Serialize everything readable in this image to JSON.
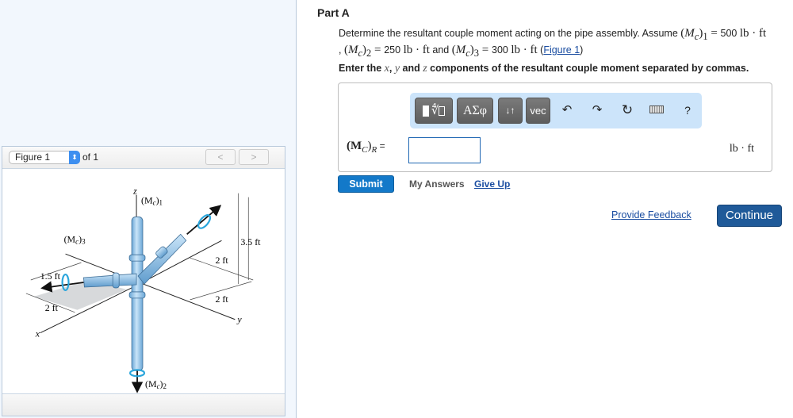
{
  "figure_panel": {
    "selected_figure": "Figure 1",
    "of_label": "of 1",
    "prev_icon": "chevron-left-icon",
    "next_icon": "chevron-right-icon",
    "diagram": {
      "labels": {
        "z_axis": "z",
        "x_axis": "x",
        "y_axis": "y",
        "mc1": "(M",
        "mc1_sub": "c",
        "mc1_idx": "1",
        "mc2": "(M",
        "mc2_sub": "c",
        "mc2_idx": "2",
        "mc3": "(M",
        "mc3_sub": "c",
        "mc3_idx": "3",
        "dim_3_5": "3.5 ft",
        "dim_2_upper": "2 ft",
        "dim_2_right": "2 ft",
        "dim_1_5": "1.5 ft",
        "dim_2_left": "2 ft"
      }
    }
  },
  "part": {
    "title": "Part A",
    "problem": {
      "text_1": "Determine the resultant couple moment acting on the pipe assembly. Assume ",
      "m1_value": "500",
      "unit": "lb · ft",
      "m2_value": "250",
      "and": " and ",
      "m3_value": "300",
      "figure_link": "Figure 1"
    },
    "instruction": {
      "pre": "Enter the ",
      "x": "x",
      "y": "y",
      "and": " and ",
      "z": "z",
      "post": " components of the resultant couple moment separated by commas."
    }
  },
  "answer": {
    "toolbar": {
      "templates_icon": "sqrt-template-icon",
      "greek_label": "ΑΣφ",
      "arrows_label": "↓↑",
      "vec_label": "vec",
      "undo_icon": "undo-icon",
      "redo_icon": "redo-icon",
      "reset_icon": "reset-icon",
      "keyboard_icon": "keyboard-icon",
      "help_label": "?"
    },
    "lhs_main": "(M",
    "lhs_sub_c": "C",
    "lhs_sub_r": "R",
    "lhs_eq": " =",
    "input_value": "",
    "unit": "lb · ft"
  },
  "actions": {
    "submit": "Submit",
    "my_answers": "My Answers",
    "give_up": "Give Up",
    "provide_feedback": "Provide Feedback",
    "continue": "Continue"
  },
  "colors": {
    "submit_bg": "#1379c9",
    "continue_bg": "#1f5a99",
    "link": "#1a4da1",
    "toolbar_bg": "#cce4fa",
    "left_panel_bg": "#f2f7fd",
    "pipe": "#a8d0ef",
    "rotation_arrow": "#2ba6dc"
  }
}
